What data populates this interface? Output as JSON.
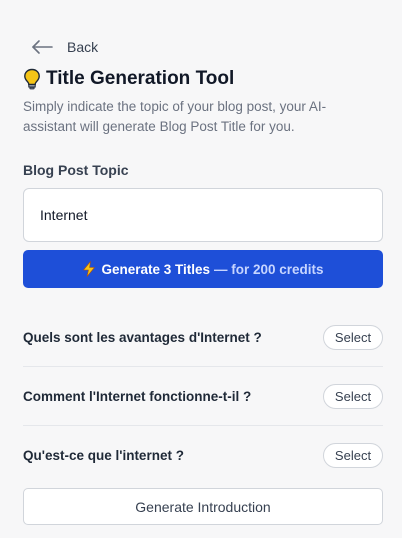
{
  "nav": {
    "back_label": "Back",
    "back_icon": "arrow-left-icon"
  },
  "header": {
    "icon": "lightbulb-icon",
    "title": "Title Generation Tool",
    "subtitle": "Simply indicate the topic of your blog post, your AI-assistant will generate Blog Post Title for you."
  },
  "form": {
    "topic_label": "Blog Post Topic",
    "topic_value": "Internet",
    "generate_icon": "lightning-icon",
    "generate_label": "Generate 3 Titles",
    "generate_credits": "— for 200 credits"
  },
  "results": [
    {
      "title": "Quels sont les avantages d'Internet ?",
      "action": "Select"
    },
    {
      "title": "Comment l'Internet fonctionne-t-il ?",
      "action": "Select"
    },
    {
      "title": "Qu'est-ce que l'internet ?",
      "action": "Select"
    }
  ],
  "footer": {
    "intro_label": "Generate Introduction"
  },
  "colors": {
    "accent": "#1e4fd8",
    "background": "#f7f7f8",
    "bulb": "#f5c518",
    "bolt": "#f5c518"
  }
}
